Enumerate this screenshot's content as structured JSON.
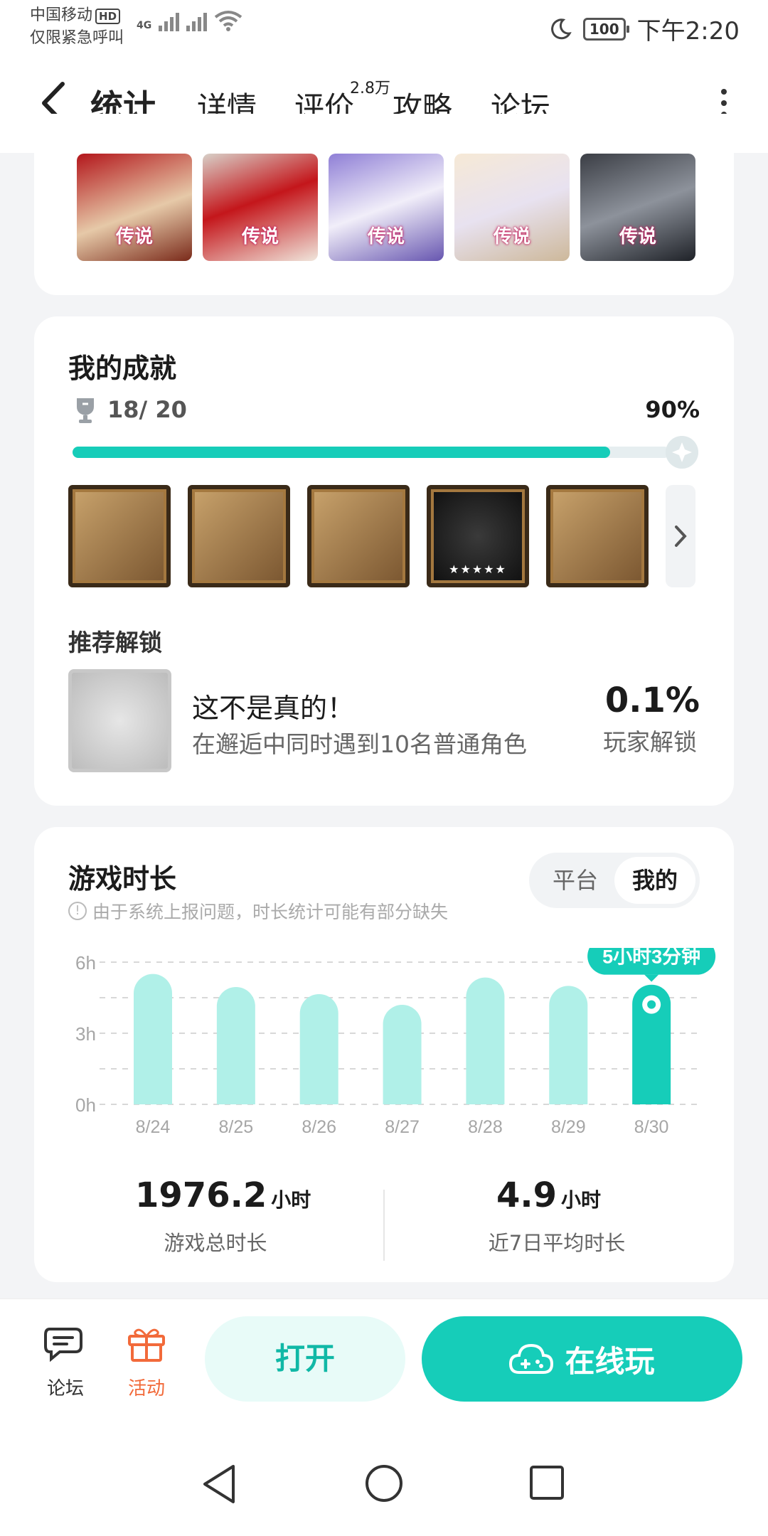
{
  "status_bar": {
    "carrier": "中国移动",
    "hd": "HD",
    "emergency": "仅限紧急呼叫",
    "network": "4G",
    "battery": "100",
    "time": "下午2:20"
  },
  "nav": {
    "tabs": [
      {
        "label": "统计"
      },
      {
        "label": "详情"
      },
      {
        "label": "评价"
      },
      {
        "label": "攻略"
      },
      {
        "label": "论坛"
      }
    ],
    "review_badge": "2.8万",
    "active_tab": "统计"
  },
  "legends": [
    {
      "label": "传说"
    },
    {
      "label": "传说"
    },
    {
      "label": "传说"
    },
    {
      "label": "传说"
    },
    {
      "label": "传说"
    }
  ],
  "achievements": {
    "title": "我的成就",
    "count": "18/ 20",
    "percent_label": "90%",
    "progress": 0.9,
    "badge_count": 5,
    "recommend": {
      "title": "推荐解锁",
      "name": "这不是真的！",
      "desc": "在邂逅中同时遇到10名普通角色",
      "percent": "0.1%",
      "percent_label": "玩家解锁"
    }
  },
  "playtime": {
    "title": "游戏时长",
    "notice": "由于系统上报问题，时长统计可能有部分缺失",
    "segments": {
      "platform": "平台",
      "mine": "我的",
      "active": "我的"
    },
    "total": {
      "value": "1976.2",
      "unit": "小时",
      "label": "游戏总时长"
    },
    "average": {
      "value": "4.9",
      "unit": "小时",
      "label": "近7日平均时长"
    },
    "highlight_label": "5小时3分钟"
  },
  "chart_data": {
    "type": "bar",
    "categories": [
      "8/24",
      "8/25",
      "8/26",
      "8/27",
      "8/28",
      "8/29",
      "8/30"
    ],
    "values": [
      5.5,
      4.95,
      4.65,
      4.2,
      5.35,
      5.0,
      5.05
    ],
    "yticks": [
      "0h",
      "3h",
      "6h"
    ],
    "ylim": [
      0,
      6
    ],
    "highlight_index": 6,
    "colors": {
      "bar": "#b0f0e8",
      "highlight": "#16cdb9",
      "grid": "#d8d8d8",
      "tick": "#a6a6a6"
    }
  },
  "bottom_bar": {
    "forum": "论坛",
    "activity": "活动",
    "open_label": "打开",
    "play_label": "在线玩"
  },
  "colors": {
    "accent": "#16cdb9",
    "activity": "#f26a3a"
  }
}
